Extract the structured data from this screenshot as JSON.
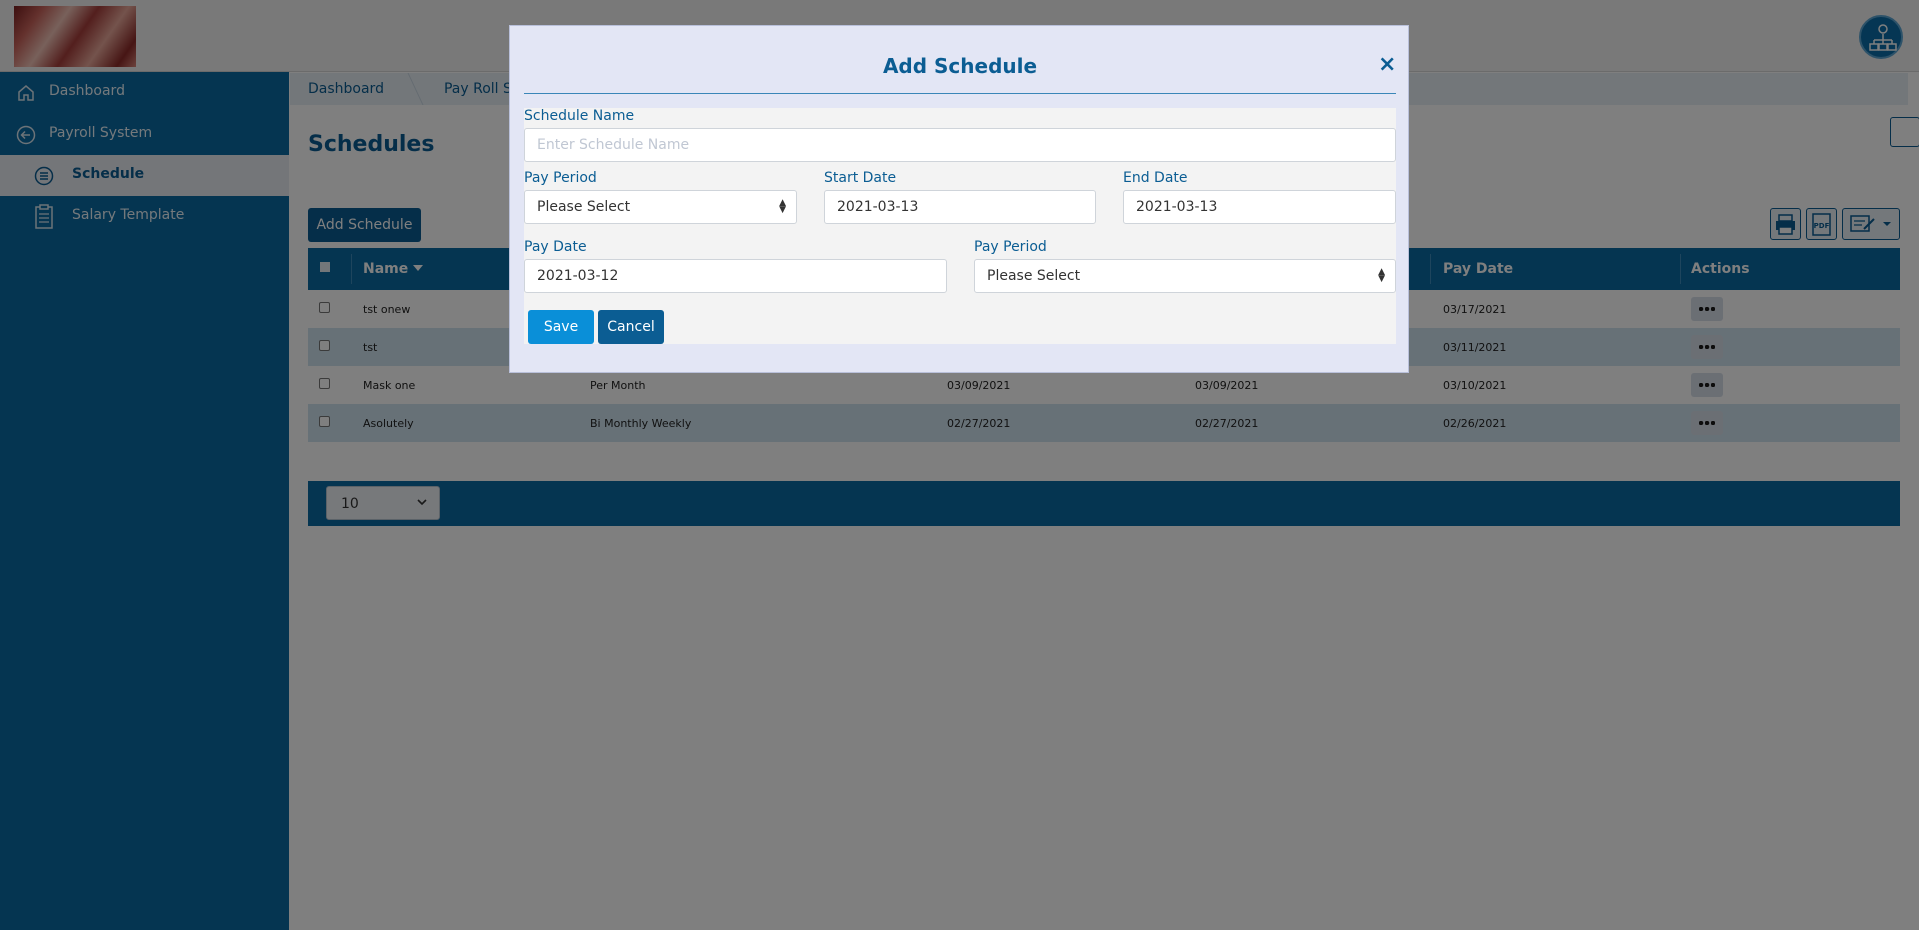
{
  "app": {
    "logo_icon": "brand-logo",
    "avatar_icon": "org-chart-icon"
  },
  "sidebar": {
    "items": [
      {
        "label": "Dashboard",
        "icon": "home-icon"
      },
      {
        "label": "Payroll System",
        "icon": "back-arrow-icon"
      },
      {
        "label": "Schedule",
        "icon": "list-icon"
      },
      {
        "label": "Salary Template",
        "icon": "clipboard-icon"
      }
    ]
  },
  "breadcrumb": [
    "Dashboard",
    "Pay Roll Syste"
  ],
  "page": {
    "title": "Schedules",
    "add_button": "Add Schedule",
    "toolbar_icons": [
      "print-icon",
      "pdf-icon",
      "export-icon"
    ]
  },
  "table": {
    "headers": {
      "name": "Name",
      "pay_date": "Pay Date",
      "actions": "Actions"
    },
    "rows": [
      {
        "name": "tst onew",
        "period": "",
        "start": "",
        "end": "",
        "pay_date": "03/17/2021"
      },
      {
        "name": "tst",
        "period": "",
        "start": "",
        "end": "",
        "pay_date": "03/11/2021"
      },
      {
        "name": "Mask one",
        "period": "Per Month",
        "start": "03/09/2021",
        "end": "03/09/2021",
        "pay_date": "03/10/2021"
      },
      {
        "name": "Asolutely",
        "period": "Bi Monthly Weekly",
        "start": "02/27/2021",
        "end": "02/27/2021",
        "pay_date": "02/26/2021"
      }
    ]
  },
  "pager": {
    "page_size": "10"
  },
  "modal": {
    "title": "Add Schedule",
    "close": "×",
    "fields": {
      "schedule_name_label": "Schedule Name",
      "schedule_name_placeholder": "Enter Schedule Name",
      "pay_period_label": "Pay Period",
      "pay_period_value": "Please Select",
      "start_date_label": "Start Date",
      "start_date_value": "2021-03-13",
      "end_date_label": "End Date",
      "end_date_value": "2021-03-13",
      "pay_date_label": "Pay Date",
      "pay_date_value": "2021-03-12",
      "pay_period2_label": "Pay Period",
      "pay_period2_value": "Please Select"
    },
    "save": "Save",
    "cancel": "Cancel"
  }
}
